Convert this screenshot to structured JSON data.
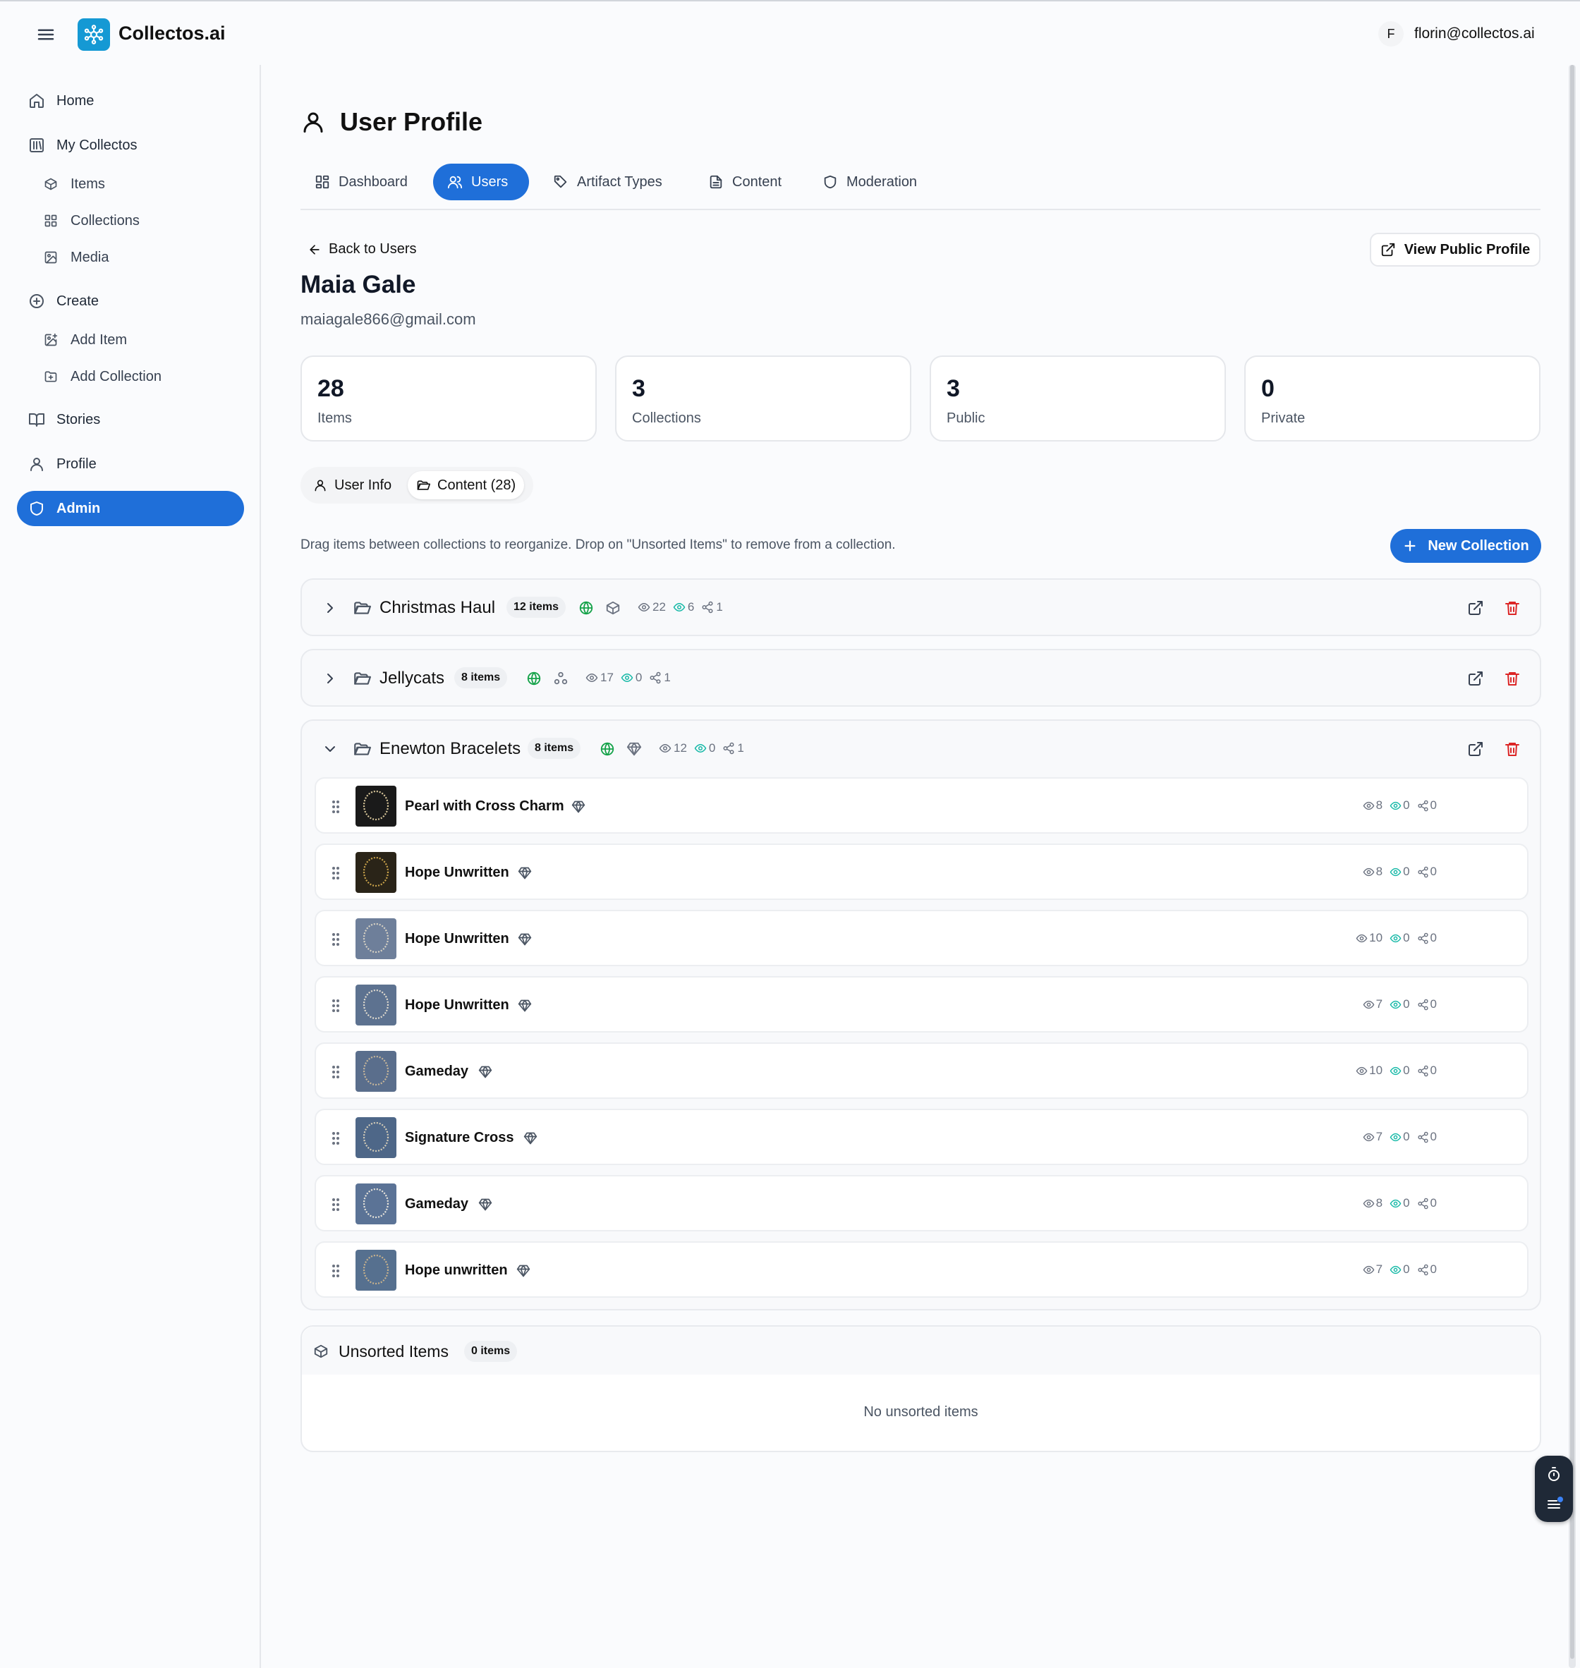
{
  "brand": {
    "name": "Collectos.ai"
  },
  "user": {
    "initial": "F",
    "email": "florin@collectos.ai"
  },
  "sidebar": {
    "items": [
      {
        "label": "Home"
      },
      {
        "label": "My Collectos"
      },
      {
        "label": "Items"
      },
      {
        "label": "Collections"
      },
      {
        "label": "Media"
      },
      {
        "label": "Create"
      },
      {
        "label": "Add Item"
      },
      {
        "label": "Add Collection"
      },
      {
        "label": "Stories"
      },
      {
        "label": "Profile"
      },
      {
        "label": "Admin"
      }
    ]
  },
  "page": {
    "title": "User Profile"
  },
  "tabs": [
    {
      "label": "Dashboard"
    },
    {
      "label": "Users"
    },
    {
      "label": "Artifact Types"
    },
    {
      "label": "Content"
    },
    {
      "label": "Moderation"
    }
  ],
  "profile": {
    "back_label": "Back to Users",
    "view_public_label": "View Public Profile",
    "name": "Maia Gale",
    "email": "maiagale866@gmail.com"
  },
  "stats": [
    {
      "value": "28",
      "label": "Items"
    },
    {
      "value": "3",
      "label": "Collections"
    },
    {
      "value": "3",
      "label": "Public"
    },
    {
      "value": "0",
      "label": "Private"
    }
  ],
  "subtabs": [
    {
      "label": "User Info"
    },
    {
      "label": "Content (28)"
    }
  ],
  "content": {
    "hint": "Drag items between collections to reorganize. Drop on \"Unsorted Items\" to remove from a collection.",
    "new_collection_label": "New Collection"
  },
  "collections": [
    {
      "name": "Christmas Haul",
      "badge": "12 items",
      "views": "22",
      "saves": "6",
      "shares": "1",
      "expanded": false
    },
    {
      "name": "Jellycats",
      "badge": "8 items",
      "views": "17",
      "saves": "0",
      "shares": "1",
      "expanded": false
    },
    {
      "name": "Enewton Bracelets",
      "badge": "8 items",
      "views": "12",
      "saves": "0",
      "shares": "1",
      "expanded": true,
      "items": [
        {
          "name": "Pearl with Cross Charm",
          "views": "8",
          "saves": "0",
          "shares": "0"
        },
        {
          "name": "Hope Unwritten",
          "views": "8",
          "saves": "0",
          "shares": "0"
        },
        {
          "name": "Hope Unwritten",
          "views": "10",
          "saves": "0",
          "shares": "0"
        },
        {
          "name": "Hope Unwritten",
          "views": "7",
          "saves": "0",
          "shares": "0"
        },
        {
          "name": "Gameday",
          "views": "10",
          "saves": "0",
          "shares": "0"
        },
        {
          "name": "Signature Cross",
          "views": "7",
          "saves": "0",
          "shares": "0"
        },
        {
          "name": "Gameday",
          "views": "8",
          "saves": "0",
          "shares": "0"
        },
        {
          "name": "Hope unwritten",
          "views": "7",
          "saves": "0",
          "shares": "0"
        }
      ]
    }
  ],
  "unsorted": {
    "title": "Unsorted Items",
    "badge": "0 items",
    "empty": "No unsorted items"
  },
  "colors": {
    "accent": "#1f6fd9",
    "globe": "#16a34a",
    "danger": "#dc2626",
    "teal": "#14b8a6",
    "logo": "#1599d4"
  }
}
